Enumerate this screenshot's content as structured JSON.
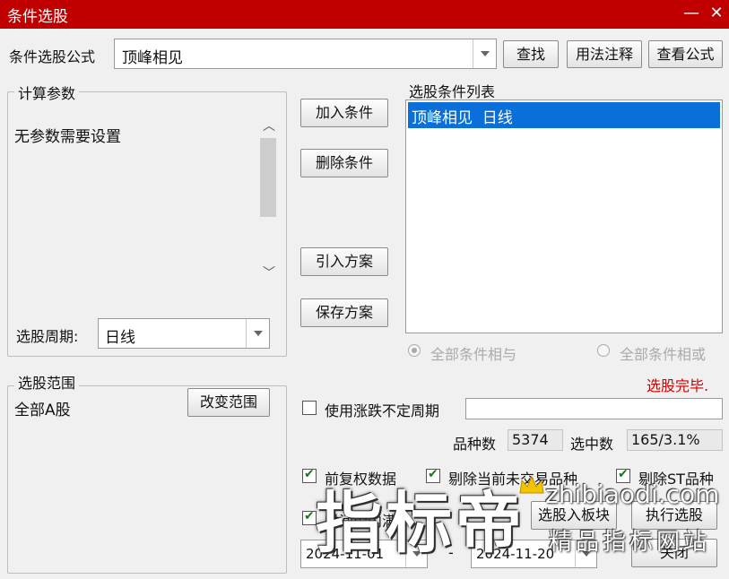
{
  "window": {
    "title": "条件选股",
    "minimize_glyph": "—",
    "close_glyph": "✕"
  },
  "formula": {
    "label": "条件选股公式",
    "value": "顶峰相见",
    "find_button": "查找",
    "usage_button": "用法注释",
    "view_button": "查看公式"
  },
  "params": {
    "group_title": "计算参数",
    "message": "无参数需要设置",
    "period_label": "选股周期:",
    "period_value": "日线"
  },
  "actions": {
    "add": "加入条件",
    "delete": "删除条件",
    "import": "引入方案",
    "save": "保存方案"
  },
  "conditions": {
    "title": "选股条件列表",
    "items": [
      "顶峰相见  日线"
    ],
    "radio_and": "全部条件相与",
    "radio_or": "全部条件相或",
    "status": "选股完毕."
  },
  "range": {
    "group_title": "选股范围",
    "value": "全部A股",
    "change_button": "改变范围"
  },
  "options": {
    "use_variable_period": "使用涨跌不定周期",
    "count_label": "品种数",
    "count_value": "5374",
    "selected_label": "选中数",
    "selected_value": "165/3.1%",
    "adjusted": "前复权数据",
    "exclude_untraded": "剔除当前未交易品种",
    "exclude_st": "剔除ST品种",
    "time_range_partial": "时间段内满",
    "to_block_button": "选股入板块",
    "execute_button": "执行选股",
    "close_button": "关闭",
    "date_from": "2024-11-01",
    "date_sep": "-",
    "date_to": "2024-11-20"
  },
  "watermark": {
    "big": "指标帝",
    "url": "zhibiaodi.com",
    "sub": "精品指标网站"
  },
  "colors": {
    "titlebar": "#c00000",
    "selection": "#0a6fd8",
    "status": "#d00000"
  }
}
